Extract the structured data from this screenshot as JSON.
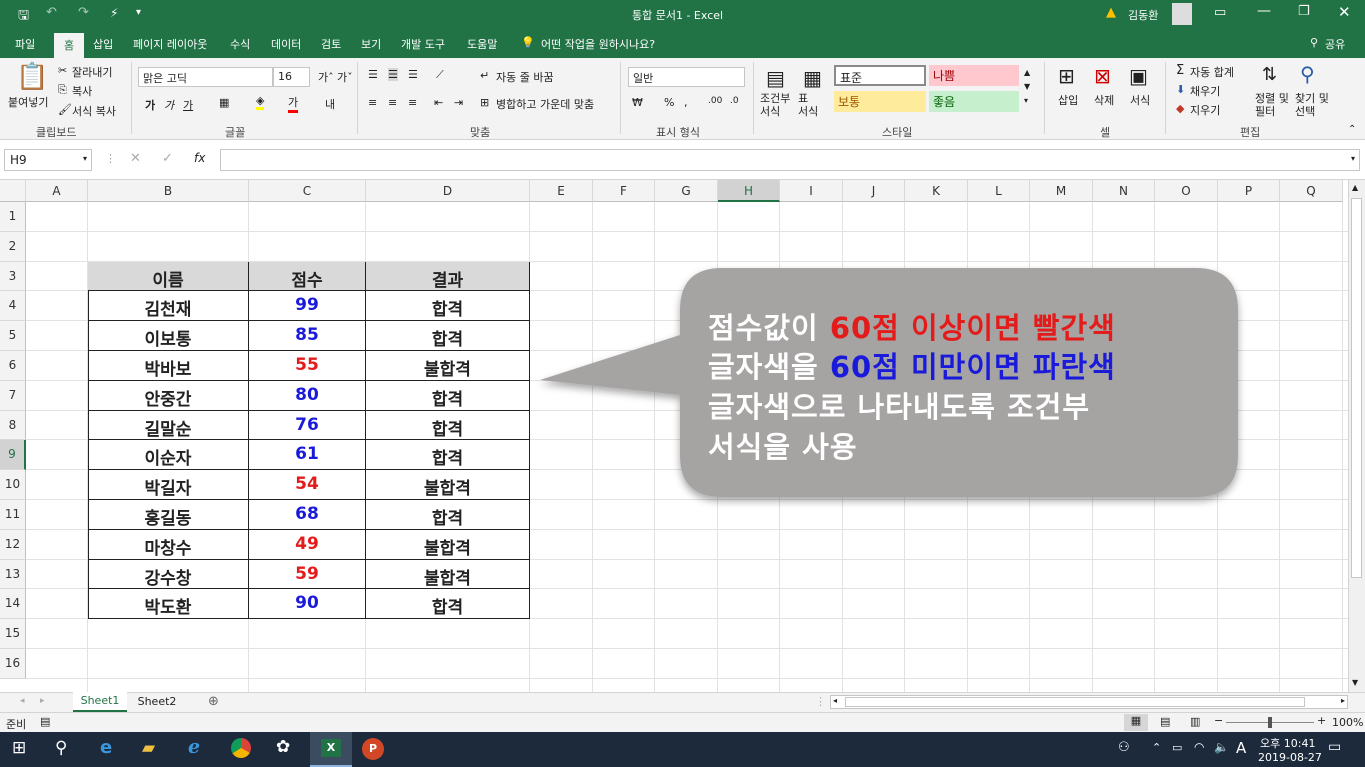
{
  "window": {
    "title": "통합 문서1  -  Excel",
    "user": "김동환",
    "share": "공유",
    "tell_me": "어떤 작업을 원하시나요?"
  },
  "tabs": [
    "파일",
    "홈",
    "삽입",
    "페이지 레이아웃",
    "수식",
    "데이터",
    "검토",
    "보기",
    "개발 도구",
    "도움말"
  ],
  "ribbon": {
    "clipboard": {
      "paste": "붙여넣기",
      "cut": "잘라내기",
      "copy": "복사",
      "format_painter": "서식 복사",
      "label": "클립보드"
    },
    "font": {
      "name": "맑은 고딕",
      "size": "16",
      "label": "글꼴",
      "bold": "가",
      "italic": "가",
      "underline": "가"
    },
    "alignment": {
      "wrap": "자동 줄 바꿈",
      "merge": "병합하고 가운데 맞춤",
      "label": "맞춤"
    },
    "number": {
      "format": "일반",
      "label": "표시 형식"
    },
    "styles": {
      "conditional": "조건부\n서식",
      "table": "표\n서식",
      "normal": "표준",
      "bad": "나쁨",
      "neutral": "보통",
      "good": "좋음",
      "label": "스타일"
    },
    "cells": {
      "insert": "삽입",
      "delete": "삭제",
      "format": "서식",
      "label": "셀"
    },
    "editing": {
      "autosum": "자동 합계",
      "fill": "채우기",
      "clear": "지우기",
      "sort": "정렬 및\n필터",
      "find": "찾기 및\n선택",
      "label": "편집"
    }
  },
  "formula_bar": {
    "name_box": "H9",
    "fx": "fx",
    "value": ""
  },
  "columns": [
    "A",
    "B",
    "C",
    "D",
    "E",
    "F",
    "G",
    "H",
    "I",
    "J",
    "K",
    "L",
    "M",
    "N",
    "O",
    "P",
    "Q"
  ],
  "rows": [
    "1",
    "2",
    "3",
    "4",
    "5",
    "6",
    "7",
    "8",
    "9",
    "10",
    "11",
    "12",
    "13",
    "14",
    "15",
    "16"
  ],
  "table": {
    "headers": [
      "이름",
      "점수",
      "결과"
    ],
    "rows": [
      {
        "name": "김천재",
        "score": "99",
        "result": "합격",
        "score_color": "#1a1adb"
      },
      {
        "name": "이보통",
        "score": "85",
        "result": "합격",
        "score_color": "#1a1adb"
      },
      {
        "name": "박바보",
        "score": "55",
        "result": "불합격",
        "score_color": "#e31b1b"
      },
      {
        "name": "안중간",
        "score": "80",
        "result": "합격",
        "score_color": "#1a1adb"
      },
      {
        "name": "길말순",
        "score": "76",
        "result": "합격",
        "score_color": "#1a1adb"
      },
      {
        "name": "이순자",
        "score": "61",
        "result": "합격",
        "score_color": "#1a1adb"
      },
      {
        "name": "박길자",
        "score": "54",
        "result": "불합격",
        "score_color": "#e31b1b"
      },
      {
        "name": "홍길동",
        "score": "68",
        "result": "합격",
        "score_color": "#1a1adb"
      },
      {
        "name": "마창수",
        "score": "49",
        "result": "불합격",
        "score_color": "#e31b1b"
      },
      {
        "name": "강수창",
        "score": "59",
        "result": "불합격",
        "score_color": "#e31b1b"
      },
      {
        "name": "박도환",
        "score": "90",
        "result": "합격",
        "score_color": "#1a1adb"
      }
    ]
  },
  "callout": {
    "line1_a": "점수값이 ",
    "line1_b": "60점 이상이면 빨간색",
    "line2_a": "글자색을 ",
    "line2_b": "60점 미만이면 파란색",
    "line3": "글자색으로 나타내도록 조건부",
    "line4": "서식을 사용",
    "red": "#e31b1b",
    "blue": "#1a1adb"
  },
  "sheets": [
    "Sheet1",
    "Sheet2"
  ],
  "status": {
    "ready": "준비",
    "zoom": "100%"
  },
  "taskbar": {
    "time": "오후 10:41",
    "date": "2019-08-27",
    "ime": "A"
  },
  "colors": {
    "excel_green": "#217346"
  }
}
